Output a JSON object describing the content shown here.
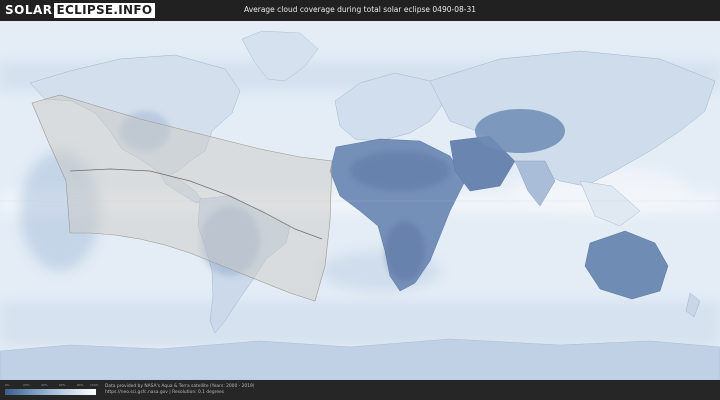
{
  "header": {
    "logo_part1": "SOLAR",
    "logo_part2": "ECLIPSE.INFO",
    "title": "Average cloud coverage during total solar eclipse 0490-08-31"
  },
  "legend": {
    "ticks": [
      "0%",
      "20%",
      "40%",
      "60%",
      "80%",
      "100%"
    ],
    "colors": [
      "#3c5c8c",
      "#7f9fc4",
      "#c2d3e6",
      "#ffffff"
    ]
  },
  "footer": {
    "credit_line1": "Data provided by NASA's Aqua & Terra satellite (Years: 2000 - 2019)",
    "credit_line2": "https://neo.sci.gsfc.nasa.gov | Resolution: 0.1 degrees"
  },
  "map": {
    "ocean_color": "#e4edf6",
    "land_cloudy_color": "#d6e2ef",
    "land_clear_color": "#6f8cb5",
    "eclipse_zone_color": "#c9c7c2"
  }
}
